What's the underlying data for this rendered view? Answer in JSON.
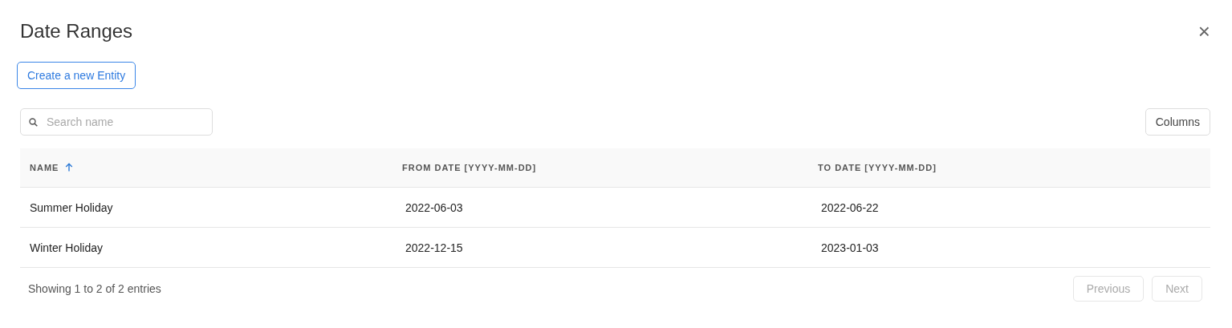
{
  "dialog": {
    "title": "Date Ranges",
    "close": "×"
  },
  "create_button": "Create a new Entity",
  "search": {
    "placeholder": "Search name"
  },
  "columns_button": "Columns",
  "table": {
    "columns": [
      {
        "label": "NAME",
        "sorted": true
      },
      {
        "label": "FROM DATE [YYYY-MM-DD]",
        "sorted": false
      },
      {
        "label": "TO DATE [YYYY-MM-DD]",
        "sorted": false
      }
    ],
    "rows": [
      [
        "Summer Holiday",
        "2022-06-03",
        "2022-06-22"
      ],
      [
        "Winter Holiday",
        "2022-12-15",
        "2023-01-03"
      ]
    ]
  },
  "footer": {
    "summary": "Showing 1 to 2 of 2 entries",
    "pagination": [
      {
        "label": "Previous",
        "disabled": true
      },
      {
        "label": "Next",
        "disabled": true
      }
    ]
  }
}
